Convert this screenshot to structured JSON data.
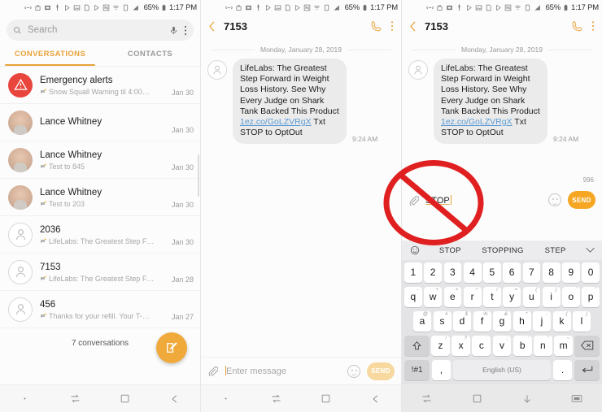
{
  "status_bar": {
    "battery_percent": "65%",
    "time": "1:17 PM",
    "icons": [
      "link-icon",
      "bag-icon",
      "screenshot-icon",
      "usb-icon",
      "play-icon",
      "image-icon",
      "sd-icon",
      "play2-icon",
      "nfc-icon",
      "wifi-icon",
      "sim-icon",
      "signal-icon"
    ]
  },
  "panel1": {
    "search": {
      "placeholder": "Search"
    },
    "tabs": [
      {
        "label": "CONVERSATIONS",
        "active": true
      },
      {
        "label": "CONTACTS",
        "active": false
      }
    ],
    "conversations": [
      {
        "name": "Emergency alerts",
        "preview": "Snow Squall Warning til 4:00…",
        "date": "Jan 30",
        "avatar": "alert"
      },
      {
        "name": "Lance Whitney",
        "preview": "",
        "date": "Jan 30",
        "avatar": "photo"
      },
      {
        "name": "Lance Whitney",
        "preview": "Test to 845",
        "date": "Jan 30",
        "avatar": "photo"
      },
      {
        "name": "Lance Whitney",
        "preview": "Test to 203",
        "date": "Jan 30",
        "avatar": "photo"
      },
      {
        "name": "2036",
        "preview": "LifeLabs: The Greatest Step F…",
        "date": "Jan 30",
        "avatar": "blank"
      },
      {
        "name": "7153",
        "preview": "LifeLabs: The Greatest Step F…",
        "date": "Jan 28",
        "avatar": "blank"
      },
      {
        "name": "456",
        "preview": "Thanks for your refill. Your T-…",
        "date": "Jan 27",
        "avatar": "blank"
      }
    ],
    "count_label": "7 conversations",
    "fab": "compose-button"
  },
  "thread": {
    "title": "7153",
    "day_divider": "Monday, January 28, 2019",
    "message": {
      "text_before_link": "LifeLabs: The Greatest Step Forward in Weight Loss History. See Why Every Judge on Shark Tank Backed This Product ",
      "link": "1ez.co/GoLZVRgX",
      "text_after_link": " Txt STOP to OptOut",
      "time": "9:24 AM"
    }
  },
  "panel2": {
    "composer": {
      "placeholder": "Enter message",
      "send_label": "SEND",
      "send_active": false
    }
  },
  "panel3": {
    "composer": {
      "value": "STOP",
      "send_label": "SEND",
      "send_active": true,
      "char_count": "996"
    },
    "keyboard": {
      "suggestions": [
        "STOP",
        "STOPPING",
        "STEP"
      ],
      "row_numbers": [
        "1",
        "2",
        "3",
        "4",
        "5",
        "6",
        "7",
        "8",
        "9",
        "0"
      ],
      "row_q": [
        {
          "k": "q",
          "sup": "-"
        },
        {
          "k": "w",
          "sup": "+"
        },
        {
          "k": "e",
          "sup": "×"
        },
        {
          "k": "r",
          "sup": "÷"
        },
        {
          "k": "t",
          "sup": "/"
        },
        {
          "k": "y",
          "sup": "="
        },
        {
          "k": "u",
          "sup": "("
        },
        {
          "k": "i",
          "sup": ")"
        },
        {
          "k": "o",
          "sup": "'"
        },
        {
          "k": "p",
          "sup": "\""
        }
      ],
      "row_a": [
        {
          "k": "a",
          "sup": "@"
        },
        {
          "k": "s",
          "sup": "#"
        },
        {
          "k": "d",
          "sup": "$"
        },
        {
          "k": "f",
          "sup": "%"
        },
        {
          "k": "g",
          "sup": "&"
        },
        {
          "k": "h",
          "sup": "*"
        },
        {
          "k": "j",
          "sup": "-"
        },
        {
          "k": "k",
          "sup": "("
        },
        {
          "k": "l",
          "sup": ")"
        }
      ],
      "row_z": [
        {
          "k": "z",
          "sup": "!"
        },
        {
          "k": "x",
          "sup": "?"
        },
        {
          "k": "c",
          "sup": ":"
        },
        {
          "k": "v",
          "sup": ";"
        },
        {
          "k": "b",
          "sup": "'"
        },
        {
          "k": "n",
          "sup": "\""
        },
        {
          "k": "m",
          "sup": "~"
        }
      ],
      "shift_key": "shift-icon",
      "backspace_key": "backspace-icon",
      "symbols_key": "!#1",
      "comma_key": ",",
      "space_key": "English (US)",
      "period_key": ".",
      "enter_key": "enter-icon"
    }
  },
  "navbar": {
    "p1": [
      "dot-icon",
      "recents-icon",
      "home-icon",
      "back-icon"
    ],
    "p2": [
      "dot-icon",
      "recents-icon",
      "home-icon",
      "back-icon"
    ],
    "p3": [
      "recents-icon",
      "home-icon",
      "hide-keyboard-icon",
      "keyboard-icon"
    ]
  },
  "annotation": {
    "type": "prohibition-sign",
    "color": "#e02020"
  },
  "colors": {
    "accent": "#f0a93b",
    "send_active": "#f5a623",
    "alert_red": "#e8453c",
    "link": "#5b9bd5"
  }
}
